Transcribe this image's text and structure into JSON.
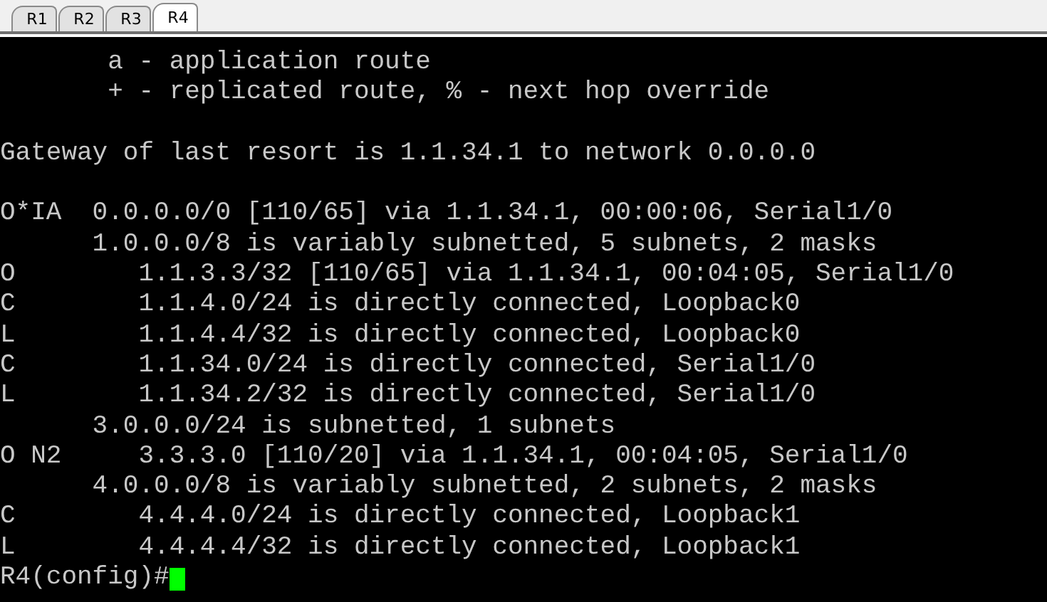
{
  "tabs": [
    {
      "label": "R1",
      "selected": false
    },
    {
      "label": "R2",
      "selected": false
    },
    {
      "label": "R3",
      "selected": false
    },
    {
      "label": "R4",
      "selected": true
    }
  ],
  "terminal": {
    "blocks": [
      [
        "       a - application route",
        "       + - replicated route, % - next hop override"
      ],
      [
        "Gateway of last resort is 1.1.34.1 to network 0.0.0.0"
      ],
      [
        "O*IA  0.0.0.0/0 [110/65] via 1.1.34.1, 00:00:06, Serial1/0",
        "      1.0.0.0/8 is variably subnetted, 5 subnets, 2 masks",
        "O        1.1.3.3/32 [110/65] via 1.1.34.1, 00:04:05, Serial1/0",
        "C        1.1.4.0/24 is directly connected, Loopback0",
        "L        1.1.4.4/32 is directly connected, Loopback0",
        "C        1.1.34.0/24 is directly connected, Serial1/0",
        "L        1.1.34.2/32 is directly connected, Serial1/0",
        "      3.0.0.0/24 is subnetted, 1 subnets",
        "O N2     3.3.3.0 [110/20] via 1.1.34.1, 00:04:05, Serial1/0",
        "      4.0.0.0/8 is variably subnetted, 2 subnets, 2 masks",
        "C        4.4.4.0/24 is directly connected, Loopback1",
        "L        4.4.4.4/32 is directly connected, Loopback1"
      ]
    ],
    "prompt": "R4(config)#"
  }
}
